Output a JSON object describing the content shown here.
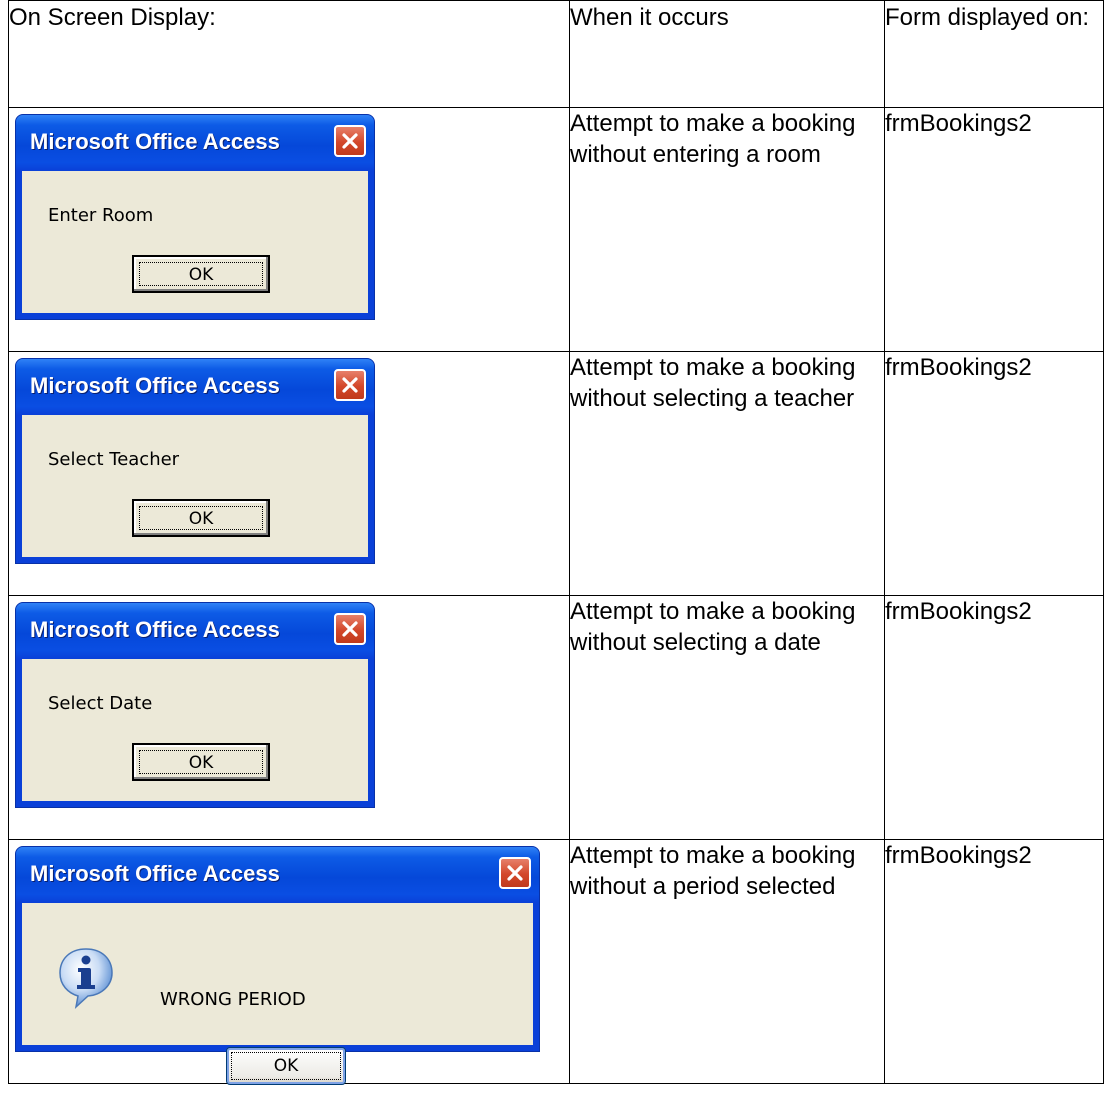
{
  "table": {
    "headers": [
      "On Screen Display:",
      "When it occurs",
      "Form displayed on:"
    ],
    "rows": [
      {
        "dialog": {
          "title": "Microsoft Office Access",
          "message": "Enter Room",
          "button": "OK",
          "icon": "none"
        },
        "when": "Attempt to make a booking without entering a room",
        "form": "frmBookings2"
      },
      {
        "dialog": {
          "title": "Microsoft Office Access",
          "message": "Select Teacher",
          "button": "OK",
          "icon": "none"
        },
        "when": "Attempt to make a booking without selecting a teacher",
        "form": "frmBookings2"
      },
      {
        "dialog": {
          "title": "Microsoft Office Access",
          "message": "Select Date",
          "button": "OK",
          "icon": "none"
        },
        "when": "Attempt to make a booking without selecting a date",
        "form": "frmBookings2"
      },
      {
        "dialog": {
          "title": "Microsoft Office Access",
          "message": "WRONG PERIOD",
          "button": "OK",
          "icon": "info-icon"
        },
        "when": "Attempt to make a booking without a period selected",
        "form": "frmBookings2"
      }
    ]
  },
  "colors": {
    "titlebar": "#0548d9",
    "dialog_body": "#ece9d8",
    "close_button": "#d3472a"
  }
}
